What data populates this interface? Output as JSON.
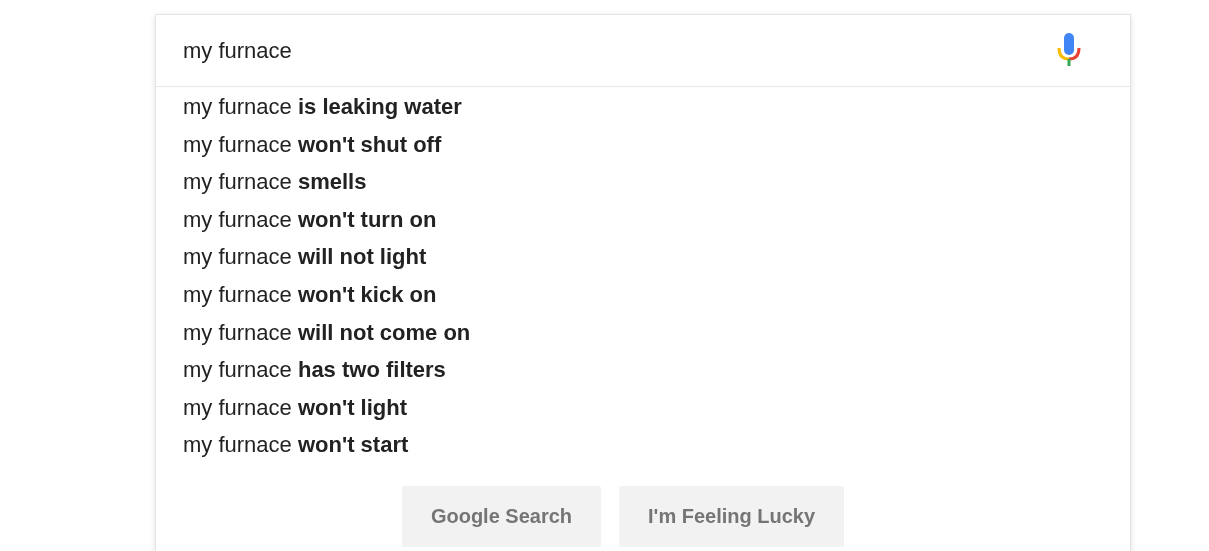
{
  "search": {
    "value": "my furnace"
  },
  "suggestions": [
    "my furnace **is leaking water**",
    "my furnace **won't shut off**",
    "my furnace **smells**",
    "my furnace **won't turn on**",
    "my furnace **will not light**",
    "my furnace **won't kick on**",
    "my furnace **will not come on**",
    "my furnace **has two filters**",
    "my furnace **won't light**",
    "my furnace **won't start**"
  ],
  "buttons": [
    "Google Search",
    "I'm Feeling Lucky"
  ]
}
